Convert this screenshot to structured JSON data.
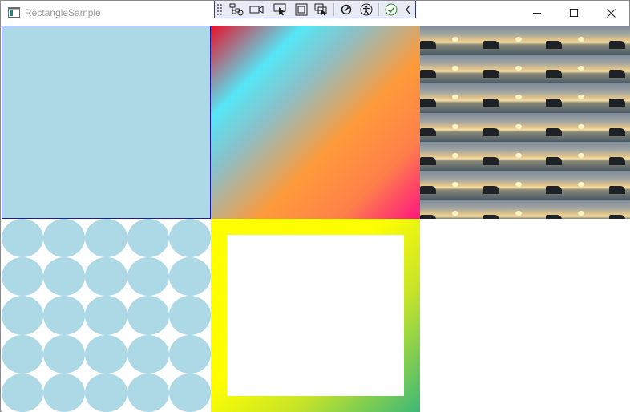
{
  "window": {
    "title": "RectangleSample",
    "controls": {
      "minimize": "minimize",
      "maximize": "maximize",
      "close": "close"
    }
  },
  "devtools": {
    "tools": [
      {
        "name": "live-visual-tree-icon"
      },
      {
        "name": "video-camera-icon"
      },
      {
        "name": "select-element-icon"
      },
      {
        "name": "display-layout-adorners-icon"
      },
      {
        "name": "track-focused-element-icon"
      },
      {
        "name": "hot-reload-icon"
      },
      {
        "name": "accessibility-icon"
      },
      {
        "name": "checkmark-circle-icon"
      },
      {
        "name": "collapse-chevron-icon"
      }
    ]
  },
  "colors": {
    "lightblue": "#add8e6",
    "border_blue": "#1a1aa0",
    "title_gray": "#9a9a9a"
  },
  "grid": {
    "cells": [
      {
        "name": "rect-solid-lightblue",
        "fill": "solid"
      },
      {
        "name": "rect-linear-gradient",
        "fill": "linear-gradient"
      },
      {
        "name": "rect-image-tiles",
        "fill": "image-brush"
      },
      {
        "name": "rect-circle-pattern",
        "fill": "drawing-brush"
      },
      {
        "name": "rect-gradient-border",
        "fill": "gradient-stroke"
      },
      {
        "name": "rect-empty",
        "fill": "none"
      }
    ]
  }
}
